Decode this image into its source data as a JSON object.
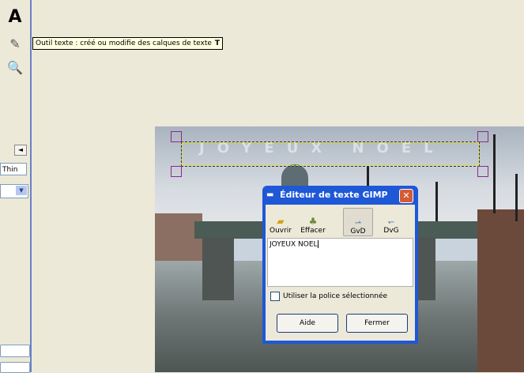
{
  "tooltip": {
    "text": "Outil texte : créé ou modifie des calques de texte",
    "shortcut": "T"
  },
  "toolbox": {
    "tools": [
      {
        "name": "text-tool-icon",
        "glyph": "A"
      },
      {
        "name": "color-picker-icon",
        "glyph": "✎"
      },
      {
        "name": "zoom-icon",
        "glyph": "🔍"
      }
    ],
    "font_value": "Thin",
    "collapse_glyph": "◄",
    "dropdown_glyph": "▼"
  },
  "canvas": {
    "text_layer": "JOYEUX NOEL"
  },
  "dialog": {
    "title": "Éditeur de texte GIMP",
    "close_glyph": "✕",
    "toolbar": {
      "open_label": "Ouvrir",
      "clear_label": "Effacer",
      "ltr_label": "GvD",
      "rtl_label": "DvG"
    },
    "text_value": "JOYEUX NOEL",
    "checkbox_label": "Utiliser la police sélectionnée",
    "help_label": "Aide",
    "close_label": "Fermer"
  },
  "colors": {
    "accent": "#1e58d6",
    "close": "#d65a35",
    "tooltip_bg": "#ffffe1"
  }
}
